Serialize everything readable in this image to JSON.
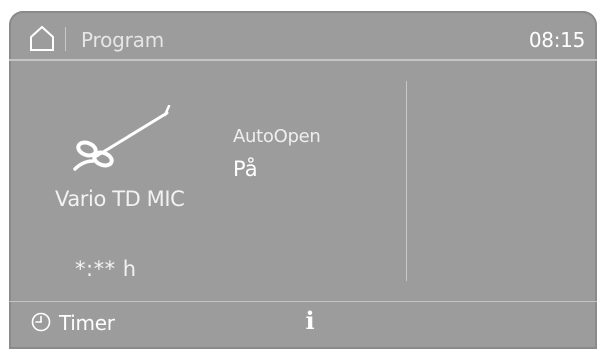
{
  "header": {
    "home_icon": "home-icon",
    "title": "Program",
    "time": "08:15"
  },
  "program": {
    "icon": "vario-wand-icon",
    "name": "Vario TD MIC",
    "duration": "*:** h"
  },
  "option": {
    "label": "AutoOpen",
    "value": "På"
  },
  "footer": {
    "timer_icon": "clock-icon",
    "timer_label": "Timer",
    "info_icon": "info-icon",
    "info_glyph": "i"
  }
}
